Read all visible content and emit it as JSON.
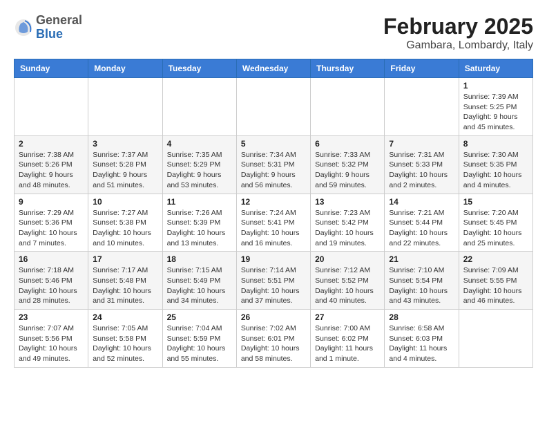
{
  "header": {
    "logo": {
      "general": "General",
      "blue": "Blue"
    },
    "title": "February 2025",
    "location": "Gambara, Lombardy, Italy"
  },
  "days_of_week": [
    "Sunday",
    "Monday",
    "Tuesday",
    "Wednesday",
    "Thursday",
    "Friday",
    "Saturday"
  ],
  "weeks": [
    [
      {
        "day": "",
        "info": ""
      },
      {
        "day": "",
        "info": ""
      },
      {
        "day": "",
        "info": ""
      },
      {
        "day": "",
        "info": ""
      },
      {
        "day": "",
        "info": ""
      },
      {
        "day": "",
        "info": ""
      },
      {
        "day": "1",
        "info": "Sunrise: 7:39 AM\nSunset: 5:25 PM\nDaylight: 9 hours and 45 minutes."
      }
    ],
    [
      {
        "day": "2",
        "info": "Sunrise: 7:38 AM\nSunset: 5:26 PM\nDaylight: 9 hours and 48 minutes."
      },
      {
        "day": "3",
        "info": "Sunrise: 7:37 AM\nSunset: 5:28 PM\nDaylight: 9 hours and 51 minutes."
      },
      {
        "day": "4",
        "info": "Sunrise: 7:35 AM\nSunset: 5:29 PM\nDaylight: 9 hours and 53 minutes."
      },
      {
        "day": "5",
        "info": "Sunrise: 7:34 AM\nSunset: 5:31 PM\nDaylight: 9 hours and 56 minutes."
      },
      {
        "day": "6",
        "info": "Sunrise: 7:33 AM\nSunset: 5:32 PM\nDaylight: 9 hours and 59 minutes."
      },
      {
        "day": "7",
        "info": "Sunrise: 7:31 AM\nSunset: 5:33 PM\nDaylight: 10 hours and 2 minutes."
      },
      {
        "day": "8",
        "info": "Sunrise: 7:30 AM\nSunset: 5:35 PM\nDaylight: 10 hours and 4 minutes."
      }
    ],
    [
      {
        "day": "9",
        "info": "Sunrise: 7:29 AM\nSunset: 5:36 PM\nDaylight: 10 hours and 7 minutes."
      },
      {
        "day": "10",
        "info": "Sunrise: 7:27 AM\nSunset: 5:38 PM\nDaylight: 10 hours and 10 minutes."
      },
      {
        "day": "11",
        "info": "Sunrise: 7:26 AM\nSunset: 5:39 PM\nDaylight: 10 hours and 13 minutes."
      },
      {
        "day": "12",
        "info": "Sunrise: 7:24 AM\nSunset: 5:41 PM\nDaylight: 10 hours and 16 minutes."
      },
      {
        "day": "13",
        "info": "Sunrise: 7:23 AM\nSunset: 5:42 PM\nDaylight: 10 hours and 19 minutes."
      },
      {
        "day": "14",
        "info": "Sunrise: 7:21 AM\nSunset: 5:44 PM\nDaylight: 10 hours and 22 minutes."
      },
      {
        "day": "15",
        "info": "Sunrise: 7:20 AM\nSunset: 5:45 PM\nDaylight: 10 hours and 25 minutes."
      }
    ],
    [
      {
        "day": "16",
        "info": "Sunrise: 7:18 AM\nSunset: 5:46 PM\nDaylight: 10 hours and 28 minutes."
      },
      {
        "day": "17",
        "info": "Sunrise: 7:17 AM\nSunset: 5:48 PM\nDaylight: 10 hours and 31 minutes."
      },
      {
        "day": "18",
        "info": "Sunrise: 7:15 AM\nSunset: 5:49 PM\nDaylight: 10 hours and 34 minutes."
      },
      {
        "day": "19",
        "info": "Sunrise: 7:14 AM\nSunset: 5:51 PM\nDaylight: 10 hours and 37 minutes."
      },
      {
        "day": "20",
        "info": "Sunrise: 7:12 AM\nSunset: 5:52 PM\nDaylight: 10 hours and 40 minutes."
      },
      {
        "day": "21",
        "info": "Sunrise: 7:10 AM\nSunset: 5:54 PM\nDaylight: 10 hours and 43 minutes."
      },
      {
        "day": "22",
        "info": "Sunrise: 7:09 AM\nSunset: 5:55 PM\nDaylight: 10 hours and 46 minutes."
      }
    ],
    [
      {
        "day": "23",
        "info": "Sunrise: 7:07 AM\nSunset: 5:56 PM\nDaylight: 10 hours and 49 minutes."
      },
      {
        "day": "24",
        "info": "Sunrise: 7:05 AM\nSunset: 5:58 PM\nDaylight: 10 hours and 52 minutes."
      },
      {
        "day": "25",
        "info": "Sunrise: 7:04 AM\nSunset: 5:59 PM\nDaylight: 10 hours and 55 minutes."
      },
      {
        "day": "26",
        "info": "Sunrise: 7:02 AM\nSunset: 6:01 PM\nDaylight: 10 hours and 58 minutes."
      },
      {
        "day": "27",
        "info": "Sunrise: 7:00 AM\nSunset: 6:02 PM\nDaylight: 11 hours and 1 minute."
      },
      {
        "day": "28",
        "info": "Sunrise: 6:58 AM\nSunset: 6:03 PM\nDaylight: 11 hours and 4 minutes."
      },
      {
        "day": "",
        "info": ""
      }
    ]
  ]
}
